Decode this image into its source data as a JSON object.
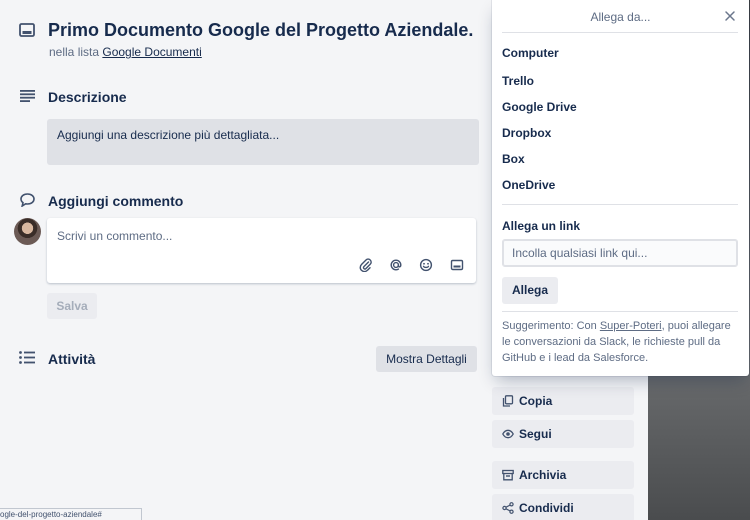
{
  "card": {
    "title": "Primo Documento Google del Progetto Aziendale.",
    "list_prefix": "nella lista",
    "list_name": "Google Documenti"
  },
  "description": {
    "heading": "Descrizione",
    "placeholder": "Aggiungi una descrizione più dettagliata..."
  },
  "comment": {
    "heading": "Aggiungi commento",
    "placeholder": "Scrivi un commento...",
    "save_label": "Salva"
  },
  "activity": {
    "heading": "Attività",
    "details_label": "Mostra Dettagli"
  },
  "sidebar": {
    "actions": [
      {
        "label": "Copia",
        "icon": "copy-icon"
      },
      {
        "label": "Segui",
        "icon": "eye-icon"
      },
      {
        "label": "Archivia",
        "icon": "archive-icon"
      },
      {
        "label": "Condividi",
        "icon": "share-icon"
      }
    ]
  },
  "popover": {
    "title": "Allega da...",
    "sources": [
      "Computer",
      "Trello",
      "Google Drive",
      "Dropbox",
      "Box",
      "OneDrive"
    ],
    "link_section": "Allega un link",
    "link_placeholder": "Incolla qualsiasi link qui...",
    "attach_label": "Allega",
    "tip_prefix": "Suggerimento: Con",
    "tip_link": "Super-Poteri",
    "tip_suffix": ", puoi allegare le conversazioni da Slack, le richieste pull da GitHub e i lead da Salesforce."
  },
  "status_url": "ogle-del-progetto-aziendale#",
  "colors": {
    "text": "#172b4d",
    "muted": "#5e6c84",
    "card_bg": "#f4f5f7",
    "button_bg": "#ebecf0"
  }
}
